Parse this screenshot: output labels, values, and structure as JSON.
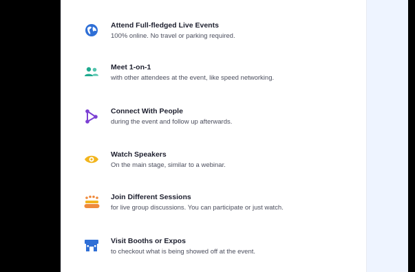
{
  "features": [
    {
      "title": "Attend Full-fledged Live Events",
      "description": "100% online. No travel or parking required.",
      "icon": "globe-icon",
      "color": "#2f6fd6"
    },
    {
      "title": "Meet 1-on-1",
      "description": "with other attendees at the event, like speed networking.",
      "icon": "people-icon",
      "color": "#1faa8f"
    },
    {
      "title": "Connect With People",
      "description": "during the event and follow up afterwards.",
      "icon": "share-icon",
      "color": "#7b3fd3"
    },
    {
      "title": "Watch Speakers",
      "description": "On the main stage, similar to a webinar.",
      "icon": "eye-icon",
      "color": "#f2b51d"
    },
    {
      "title": "Join Different Sessions",
      "description": "for live group discussions. You can participate or just watch.",
      "icon": "group-table-icon",
      "color": "#ef8a3c"
    },
    {
      "title": "Visit Booths or Expos",
      "description": "to checkout what is being showed off at the event.",
      "icon": "booth-icon",
      "color": "#2f6fd6"
    }
  ]
}
